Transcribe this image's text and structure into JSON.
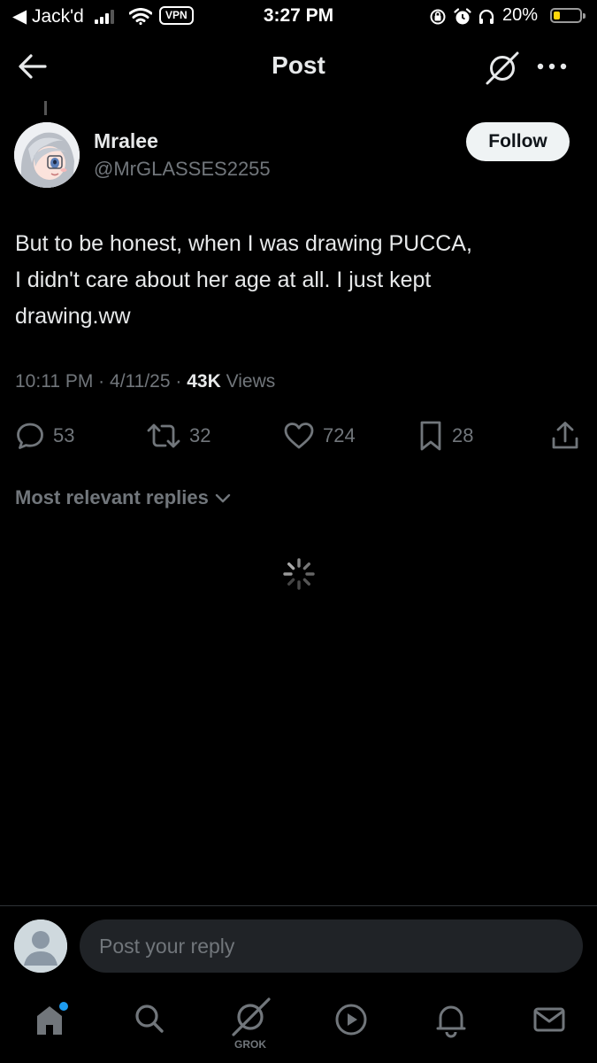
{
  "status_bar": {
    "back_app": "◀ Jack'd",
    "vpn": "VPN",
    "time": "3:27 PM",
    "battery": "20%"
  },
  "header": {
    "title": "Post"
  },
  "author": {
    "name": "Mralee",
    "handle": "@MrGLASSES2255",
    "follow_label": "Follow"
  },
  "post": {
    "lines": [
      "But to be honest, when I was drawing PUCCA,",
      "I didn't care about her age at all. I just kept",
      "drawing.ww"
    ],
    "time": "10:11 PM",
    "sep1": "·",
    "date": "4/11/25",
    "sep2": "·",
    "views_count": "43K",
    "views_label": "Views"
  },
  "actions": {
    "replies": "53",
    "reposts": "32",
    "likes": "724",
    "bookmarks": "28"
  },
  "replies_sort": {
    "label": "Most relevant replies"
  },
  "compose": {
    "placeholder": "Post your reply"
  },
  "bottom_nav": {
    "grok_label": "GROK"
  },
  "colors": {
    "background": "#000000",
    "text": "#e7e9ea",
    "secondary": "#71767b",
    "notification_dot": "#1d9bf0",
    "battery_low": "#ffd60a"
  }
}
